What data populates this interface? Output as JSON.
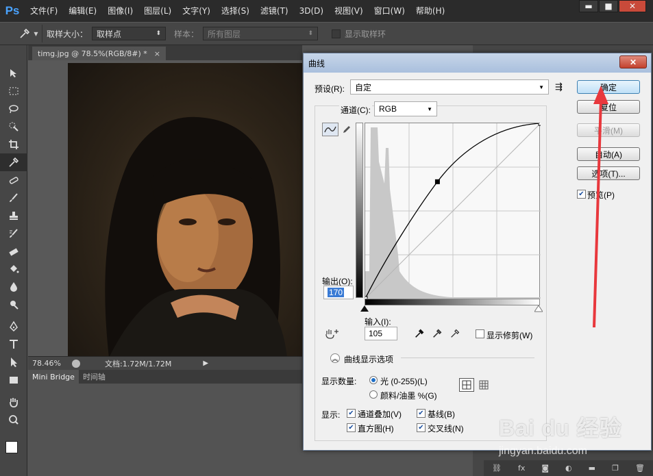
{
  "app": {
    "logo": "Ps",
    "menu": [
      "文件(F)",
      "编辑(E)",
      "图像(I)",
      "图层(L)",
      "文字(Y)",
      "选择(S)",
      "滤镜(T)",
      "3D(D)",
      "视图(V)",
      "窗口(W)",
      "帮助(H)"
    ],
    "window_controls": {
      "minimize": "▬",
      "maximize": "■",
      "close": "✕"
    }
  },
  "options_bar": {
    "sample_size_label": "取样大小：",
    "sample_size_value": "取样点",
    "sample_label": "样本：",
    "sample_value": "所有图层",
    "show_ring_label": "显示取样环"
  },
  "tools": [
    "move-icon",
    "marquee-icon",
    "lasso-icon",
    "quick-select-icon",
    "crop-icon",
    "eyedropper-icon",
    "healing-icon",
    "brush-icon",
    "stamp-icon",
    "history-brush-icon",
    "eraser-icon",
    "bucket-icon",
    "blur-icon",
    "dodge-icon",
    "pen-icon",
    "type-icon",
    "path-select-icon",
    "shape-icon",
    "hand-icon",
    "zoom-icon"
  ],
  "document": {
    "tab_title": "timg.jpg @ 78.5%(RGB/8#) *",
    "tab_close": "×",
    "zoom": "78.46%",
    "doc_info": "文档:1.72M/1.72M"
  },
  "bottom_panel": {
    "tabs": [
      "Mini Bridge",
      "时间轴"
    ]
  },
  "curves_dialog": {
    "title": "曲线",
    "close": "✕",
    "preset_label": "预设(R):",
    "preset_value": "自定",
    "channel_label": "通道(C):",
    "channel_value": "RGB",
    "output_label": "输出(O):",
    "output_value": "170",
    "input_label": "输入(I):",
    "input_value": "105",
    "show_clipping_label": "显示修剪(W)",
    "display_options_label": "曲线显示选项",
    "show_amount_label": "显示数量:",
    "light_option": "光 (0-255)(L)",
    "pigment_option": "颜料/油墨 %(G)",
    "show_label": "显示:",
    "checks": {
      "channel_overlay": "通道叠加(V)",
      "baseline": "基线(B)",
      "histogram": "直方图(H)",
      "intersection": "交叉线(N)"
    },
    "buttons": {
      "ok": "确定",
      "reset": "复位",
      "smooth": "平滑(M)",
      "auto": "自动(A)",
      "options": "选项(T)..."
    },
    "preview_label": "预览(P)",
    "curve": {
      "points": [
        [
          0,
          0
        ],
        [
          105,
          170
        ],
        [
          255,
          255
        ]
      ]
    }
  },
  "watermark": {
    "logo": "Bai du 经验",
    "url": "jingyan.baidu.com"
  },
  "colors": {
    "accent": "#4aa3ff",
    "arrow": "#e8383d",
    "dialog_bg": "#f0f0f0"
  }
}
